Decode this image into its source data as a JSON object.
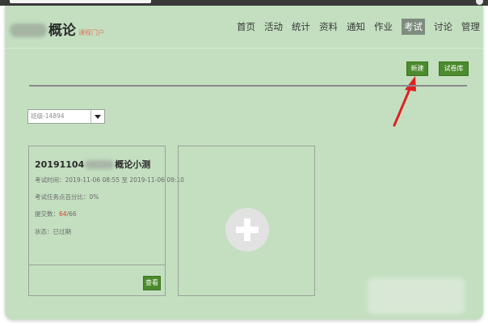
{
  "header": {
    "logo_title": "概论",
    "logo_sub": "课程门户"
  },
  "nav": {
    "items": [
      "首页",
      "活动",
      "统计",
      "资料",
      "通知",
      "作业",
      "考试",
      "讨论",
      "管理"
    ],
    "active": "考试"
  },
  "toolbar": {
    "new_label": "新建",
    "bank_label": "试卷库"
  },
  "class_select": {
    "value": "班级-14894"
  },
  "exam_card": {
    "title_prefix": "20191104",
    "title_suffix": "概论小测",
    "time": "考试时间：2019-11-06 08:55 至 2019-11-06 09:10",
    "pass_rate": "考试任务点百分比：0%",
    "submit_label": "提交数：",
    "submit_count": "64",
    "submit_total": "/66",
    "status_label": "状态：",
    "status_value": "已过期",
    "view_label": "查看"
  },
  "colors": {
    "background": "#c3dfc0",
    "accent_button": "#4c8b2d",
    "arrow": "#e02020",
    "active_tab": "#7e8b7e"
  }
}
